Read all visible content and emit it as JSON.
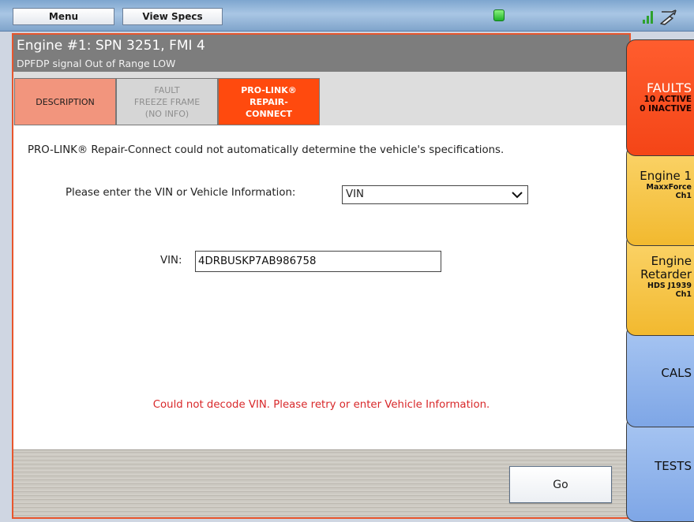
{
  "topbar": {
    "menu_label": "Menu",
    "view_specs_label": "View Specs",
    "status_color": "#22b52c"
  },
  "fault": {
    "title": "Engine #1: SPN 3251, FMI 4",
    "subtitle": "DPFDP signal Out of Range LOW"
  },
  "subtabs": [
    {
      "label": "DESCRIPTION"
    },
    {
      "line1": "FAULT",
      "line2": "FREEZE FRAME",
      "line3": "(NO INFO)"
    },
    {
      "line1": "PRO-LINK®",
      "line2": "REPAIR-",
      "line3": "CONNECT"
    }
  ],
  "content": {
    "message": "PRO-LINK® Repair-Connect could not automatically determine the vehicle's specifications.",
    "select_label": "Please enter the VIN or Vehicle Information:",
    "select_value": "VIN",
    "vin_label": "VIN:",
    "vin_value": "4DRBUSKP7AB986758",
    "error": "Could not decode VIN. Please retry or enter Vehicle Information."
  },
  "footer": {
    "go_label": "Go"
  },
  "sidebar": {
    "faults": {
      "label": "FAULTS",
      "active": "10 ACTIVE",
      "inactive": "0 INACTIVE"
    },
    "engine1": {
      "label": "Engine 1",
      "sub1": "MaxxForce",
      "sub2": "Ch1"
    },
    "retarder": {
      "label1": "Engine",
      "label2": "Retarder",
      "sub1": "HDS J1939",
      "sub2": "Ch1"
    },
    "cals": {
      "label": "CALS"
    },
    "tests": {
      "label": "TESTS"
    }
  },
  "colors": {
    "accent": "#ff4a0e",
    "error": "#d8282a",
    "header": "#7d7d7d"
  }
}
